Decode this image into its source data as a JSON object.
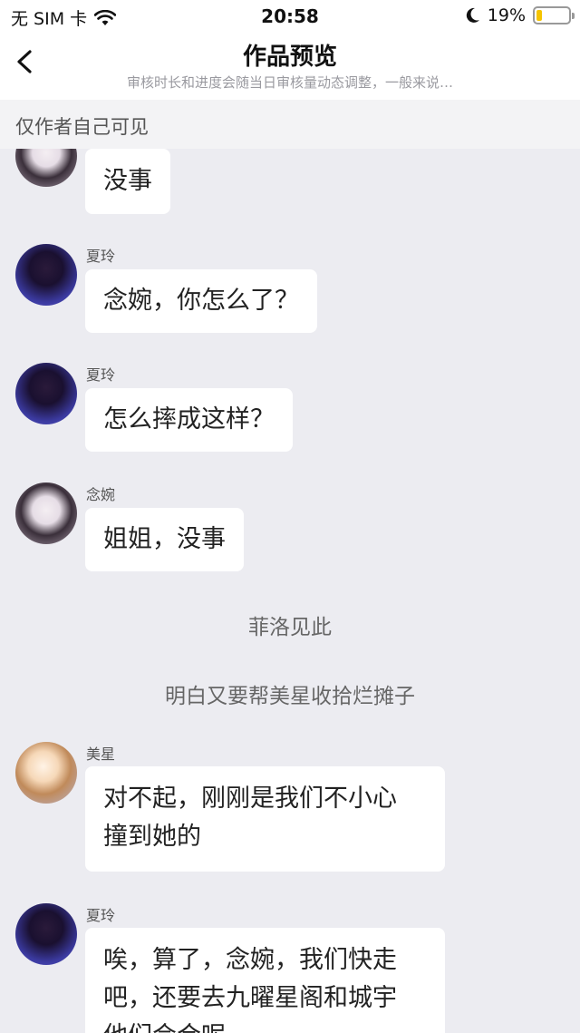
{
  "status_bar": {
    "carrier": "无 SIM 卡",
    "time": "20:58",
    "battery": "19%",
    "battery_level": 0.19
  },
  "nav": {
    "title": "作品预览",
    "subtitle": "审核时长和进度会随当日审核量动态调整，一般来说…"
  },
  "notice": "仅作者自己可见",
  "messages": [
    {
      "speaker": "",
      "text": "没事",
      "avatar": "avatar-girl"
    },
    {
      "speaker": "夏玲",
      "text": "念婉，你怎么了？",
      "avatar": "avatar-dark"
    },
    {
      "speaker": "夏玲",
      "text": "怎么摔成这样？",
      "avatar": "avatar-dark"
    },
    {
      "speaker": "念婉",
      "text": "姐姐，没事",
      "avatar": "avatar-girl"
    },
    {
      "narration": "菲洛见此"
    },
    {
      "narration": "明白又要帮美星收拾烂摊子"
    },
    {
      "speaker": "美星",
      "line1": "对不起，刚刚是我们不小心",
      "line2": "撞到她的",
      "avatar": "avatar-angel"
    },
    {
      "speaker": "夏玲",
      "line1": "唉，算了，念婉，我们快走",
      "line2": "吧，还要去九曜星阁和城宇",
      "line3": "他们会合呢",
      "avatar": "avatar-dark"
    }
  ]
}
